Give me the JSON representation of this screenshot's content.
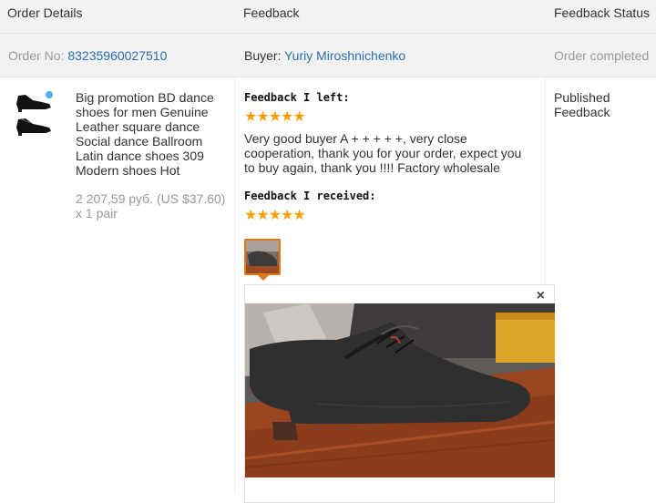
{
  "header": {
    "order_details": "Order Details",
    "feedback": "Feedback",
    "feedback_status": "Feedback Status"
  },
  "order": {
    "order_no_label": "Order No:",
    "order_no": "83235960027510",
    "buyer_label": "Buyer:",
    "buyer_name": "Yuriy Miroshnichenko",
    "status": "Order completed"
  },
  "product": {
    "title": "Big promotion BD dance shoes for men Genuine Leather square dance Social dance Ballroom Latin dance shoes 309 Modern shoes Hot",
    "price": "2 207,59 руб. (US $37.60) x 1 pair"
  },
  "feedback_left": {
    "heading": "Feedback I left:",
    "stars": "★★★★★",
    "rating": 5,
    "text": "Very good buyer A + + + + +, very close cooperation, thank you for your order, expect you to buy again, thank you !!!! Factory wholesale"
  },
  "feedback_received": {
    "heading": "Feedback I received:",
    "stars": "★★★★★",
    "rating": 5,
    "photo_icon": "shoe-photo-thumbnail",
    "close": "×"
  },
  "feedback_status": {
    "text": "Published Feedback"
  },
  "colors": {
    "header_bg": "#f2f2f2",
    "link": "#2a6fb5",
    "star": "#f5a00c",
    "thumb_border": "#e07a17"
  }
}
